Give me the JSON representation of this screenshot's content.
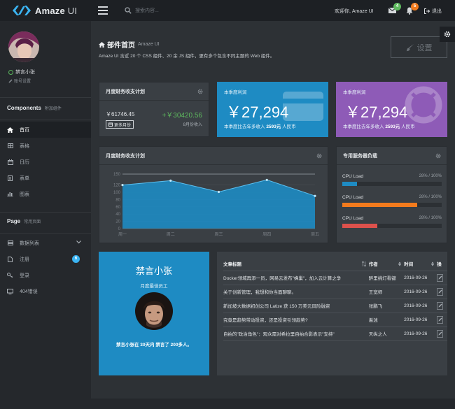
{
  "header": {
    "logo_text": "Amaze",
    "logo_sub": "UI",
    "search_placeholder": "搜索内容...",
    "welcome": "欢迎你, Amaze UI",
    "mail_count": "4",
    "bell_count": "5",
    "logout": "退出"
  },
  "sidebar": {
    "user_name": "禁言小张",
    "account_settings": "账号设置",
    "components_title": "Components",
    "components_sub": "附加组件",
    "items": [
      {
        "label": "首页"
      },
      {
        "label": "表格"
      },
      {
        "label": "日历"
      },
      {
        "label": "表单"
      },
      {
        "label": "图表"
      }
    ],
    "page_title": "Page",
    "page_sub": "常用页面",
    "page_items": [
      {
        "label": "数据列表"
      },
      {
        "label": "注册",
        "badge": "6"
      },
      {
        "label": "登录"
      },
      {
        "label": "404错误"
      }
    ]
  },
  "page_header": {
    "title": "部件首页",
    "subtitle": "Amaze UI",
    "desc": "Amaze UI 含近 20 个 CSS 组件、20 余 JS 组件，更有多个包含不同主题的 Web 组件。",
    "settings_label": "设置"
  },
  "finance": {
    "title": "月度财务收支计划",
    "value": "￥61746.45",
    "delta": "+￥30420.56",
    "more_label": "更多月份",
    "note": "8月份收入"
  },
  "stats": [
    {
      "label": "本季度利润",
      "value": "￥27,294",
      "foot_pre": "本季度比去年多收入",
      "foot_num": "2593元",
      "foot_post": "人民币",
      "color": "#1e8bc3"
    },
    {
      "label": "本季度利润",
      "value": "￥27,294",
      "foot_pre": "本季度比去年多收入",
      "foot_num": "2593元",
      "foot_post": "人民币",
      "color": "#8e5bb7"
    }
  ],
  "chart_panel_title": "月度财务收支计划",
  "chart_data": {
    "type": "area",
    "categories": [
      "周一",
      "周二",
      "周三",
      "周四",
      "周五"
    ],
    "values": [
      120,
      132,
      101,
      134,
      90
    ],
    "reference_line": 150,
    "ylim": [
      0,
      150
    ],
    "yticks": [
      0,
      20,
      40,
      60,
      80,
      100,
      120,
      150
    ],
    "color": "#1e8bc3",
    "grid": true
  },
  "server": {
    "title": "专用服务器负载",
    "rows": [
      {
        "label": "CPU Load",
        "pct_text": "28% / 100%",
        "value": 0.15,
        "color": "#1e8bc3"
      },
      {
        "label": "CPU Load",
        "pct_text": "28% / 100%",
        "value": 0.75,
        "color": "#f37b1d"
      },
      {
        "label": "CPU Load",
        "pct_text": "28% / 100%",
        "value": 0.35,
        "color": "#dd514c"
      }
    ]
  },
  "profile": {
    "name": "禁言小张",
    "role": "月度最佳员工",
    "bio": "禁言小张在 30天内 禁言了 200多人。"
  },
  "articles": {
    "headers": [
      "文章标题",
      "作者",
      "时间",
      "操"
    ],
    "rows": [
      [
        "Docker领域再添一员，网易云发布\"蜂巢\"，加入云计算之争",
        "醉里挑灯看键",
        "2016-09-26"
      ],
      [
        "关于创新管理，我想和你当面聊聊。",
        "王宽师",
        "2016-09-26"
      ],
      [
        "新加坡大数据初创公司 Latize 获 150 万美元风险融资",
        "张鹏飞",
        "2016-09-26"
      ],
      [
        "究竟是趋势带动投资，还是投资引领趋势?",
        "着迷",
        "2016-09-26"
      ],
      [
        "自拍的\"政治角色\"：观众需对希拉里自拍合影表示\"支持\"",
        "天纵之人",
        "2016-09-26"
      ]
    ]
  }
}
